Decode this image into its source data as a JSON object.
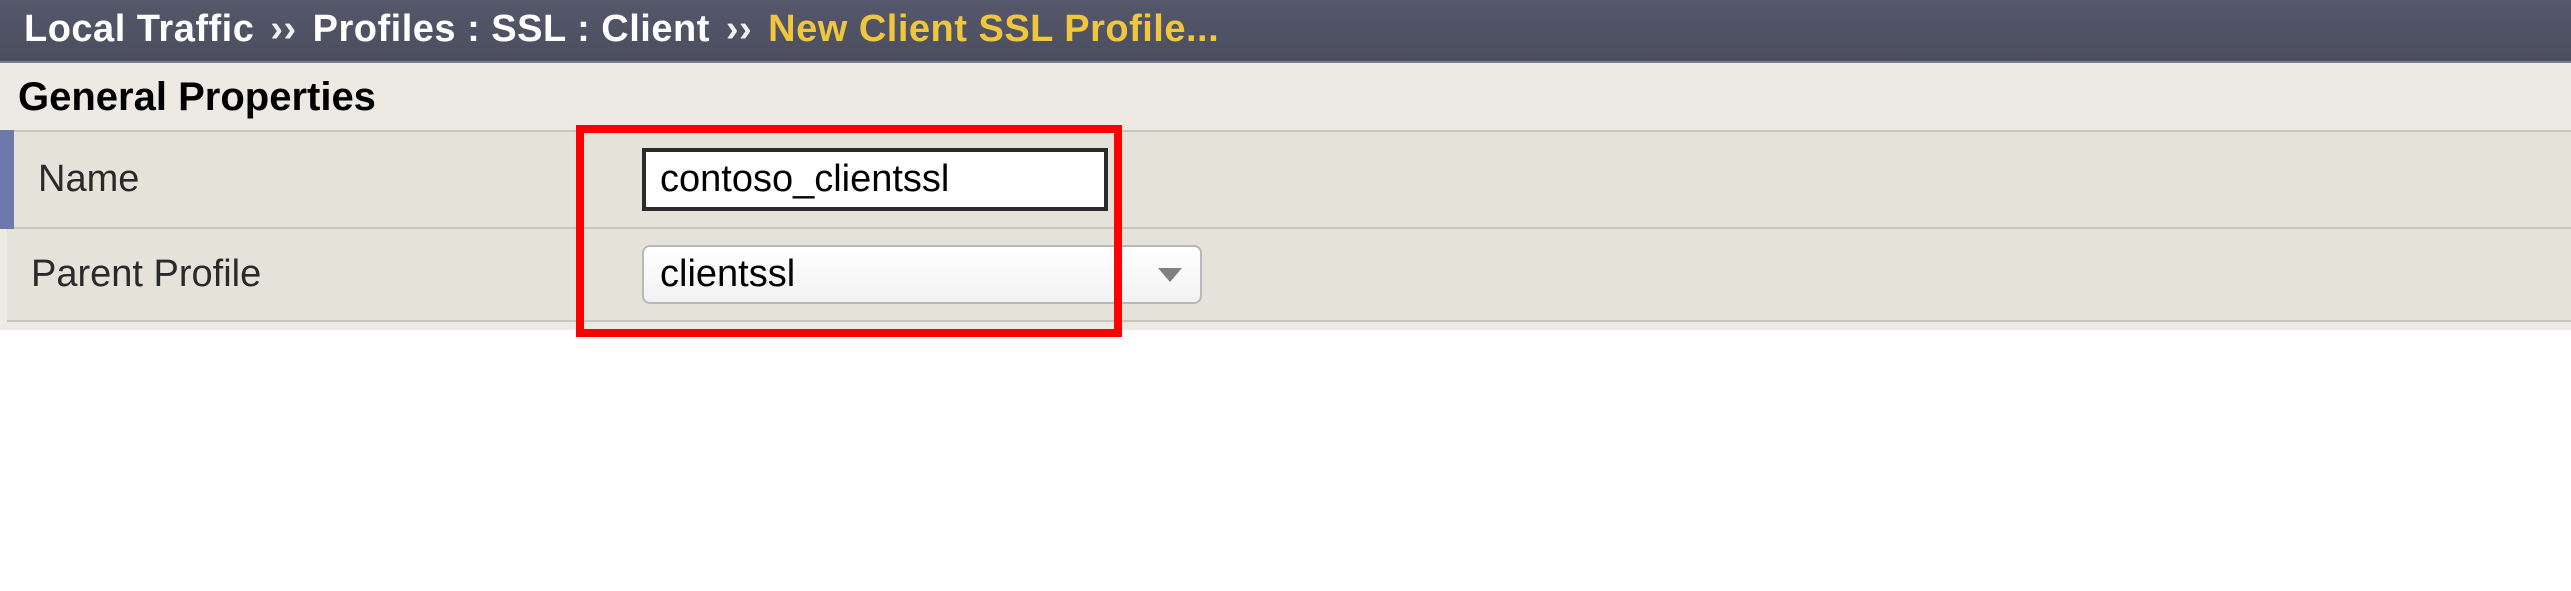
{
  "breadcrumb": {
    "seg1": "Local Traffic",
    "sep1": "››",
    "seg2": "Profiles : SSL : Client",
    "sep2": "››",
    "active": "New Client SSL Profile..."
  },
  "section_title": "General Properties",
  "rows": {
    "name_label": "Name",
    "name_value": "contoso_clientssl",
    "parent_label": "Parent Profile",
    "parent_value": "clientssl"
  }
}
